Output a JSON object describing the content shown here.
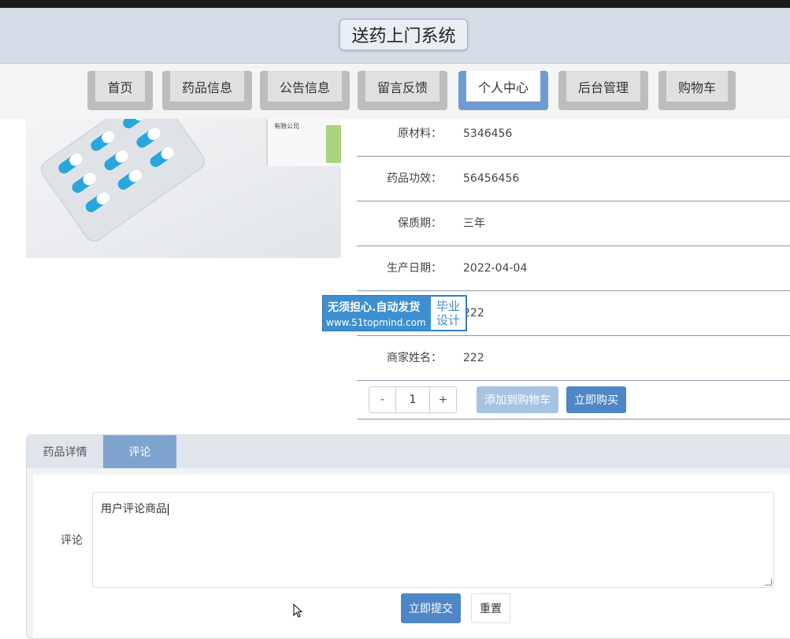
{
  "header": {
    "title": "送药上门系统"
  },
  "nav": {
    "items": [
      {
        "label": "首页"
      },
      {
        "label": "药品信息"
      },
      {
        "label": "公告信息"
      },
      {
        "label": "留言反馈"
      },
      {
        "label": "个人中心",
        "active": true
      },
      {
        "label": "后台管理"
      },
      {
        "label": "购物车"
      }
    ]
  },
  "product": {
    "image_label": "有限公司",
    "fields": [
      {
        "key": "原材料：",
        "value": "5346456"
      },
      {
        "key": "药品功效：",
        "value": "56456456"
      },
      {
        "key": "保质期：",
        "value": "三年"
      },
      {
        "key": "生产日期：",
        "value": "2022-04-04"
      },
      {
        "key": "",
        "value": "222"
      },
      {
        "key": "商家姓名：",
        "value": "222"
      }
    ]
  },
  "watermark": {
    "line1": "无须担心.自动发货",
    "line2": "www.51topmind.com",
    "badge_line1": "毕业",
    "badge_line2": "设计"
  },
  "purchase": {
    "minus": "-",
    "quantity": "1",
    "plus": "+",
    "add_to_cart": "添加到购物车",
    "buy_now": "立即购买"
  },
  "tabs": [
    {
      "label": "药品详情"
    },
    {
      "label": "评论",
      "active": true
    }
  ],
  "comment": {
    "label": "评论",
    "value": "用户评论商品",
    "submit": "立即提交",
    "reset": "重置"
  },
  "colors": {
    "accent": "#4f87c6",
    "header_bg": "#d4dde6",
    "nav_active": "#6f9bd1"
  }
}
